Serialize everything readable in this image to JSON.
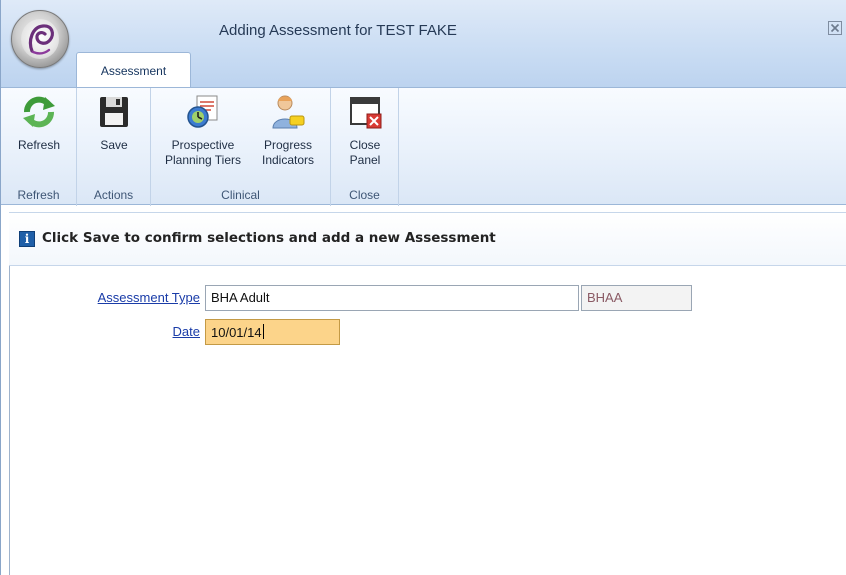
{
  "window": {
    "title": "Adding Assessment for TEST FAKE"
  },
  "tabs": [
    {
      "label": "Assessment",
      "active": true
    }
  ],
  "ribbon": {
    "groups": [
      {
        "label": "Refresh",
        "buttons": [
          {
            "label": "Refresh",
            "icon": "refresh-icon"
          }
        ]
      },
      {
        "label": "Actions",
        "buttons": [
          {
            "label": "Save",
            "icon": "floppy-disk-icon"
          }
        ]
      },
      {
        "label": "Clinical",
        "buttons": [
          {
            "label_line1": "Prospective",
            "label_line2": "Planning Tiers",
            "icon": "clipboard-clock-icon"
          },
          {
            "label_line1": "Progress",
            "label_line2": "Indicators",
            "icon": "person-indicator-icon"
          }
        ]
      },
      {
        "label": "Close",
        "buttons": [
          {
            "label_line1": "Close",
            "label_line2": "Panel",
            "icon": "close-panel-icon"
          }
        ]
      }
    ]
  },
  "info": {
    "icon": "info-icon",
    "icon_glyph": "i",
    "message": "Click Save to confirm selections and add a new Assessment"
  },
  "form": {
    "assessment_type": {
      "label": "Assessment Type",
      "value": "BHA Adult",
      "code": "BHAA"
    },
    "date": {
      "label": "Date",
      "value": "10/01/14"
    }
  },
  "colors": {
    "title_bar": "#c9dcf3",
    "ribbon": "#e9f1fb",
    "link_label": "#1a3ca8",
    "date_highlight": "#fcd48a",
    "info_icon": "#1f5fa8"
  }
}
